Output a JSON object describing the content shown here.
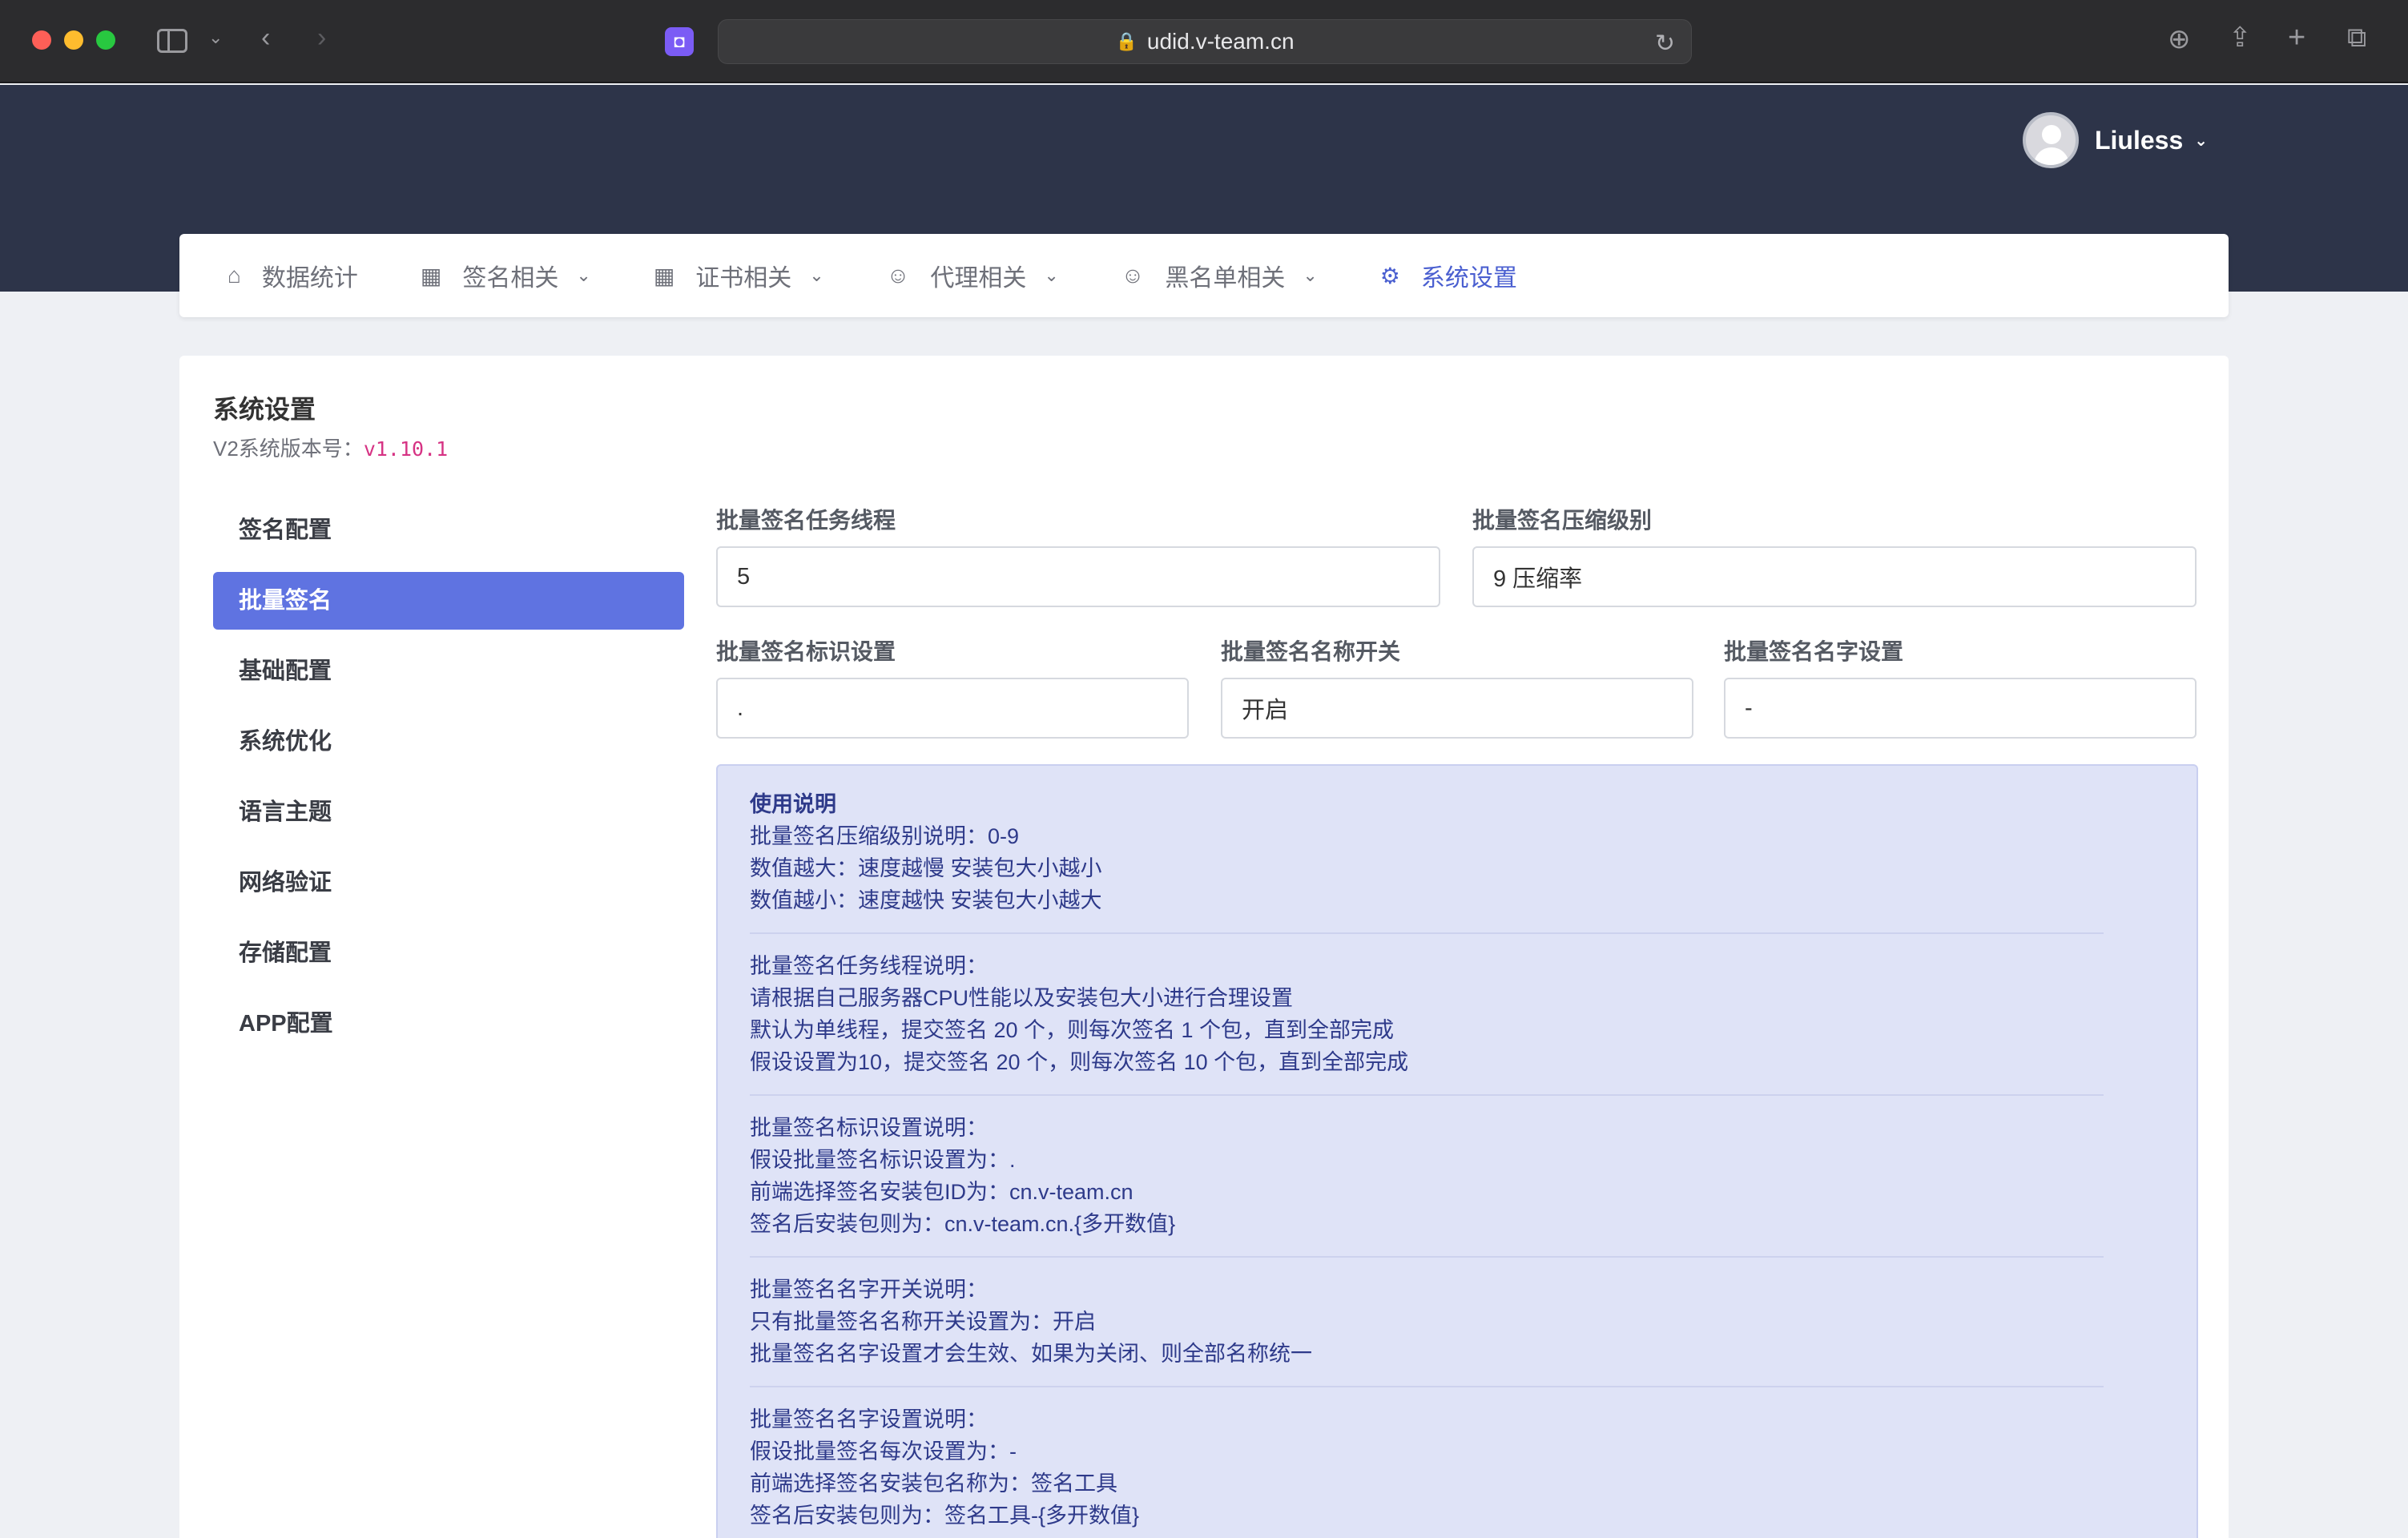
{
  "browser": {
    "url": "udid.v-team.cn"
  },
  "header": {
    "username": "Liuless"
  },
  "nav": {
    "items": [
      {
        "label": "数据统计",
        "icon": "home-icon",
        "dropdown": false
      },
      {
        "label": "签名相关",
        "icon": "grid-icon",
        "dropdown": true
      },
      {
        "label": "证书相关",
        "icon": "grid-icon",
        "dropdown": true
      },
      {
        "label": "代理相关",
        "icon": "users-icon",
        "dropdown": true
      },
      {
        "label": "黑名单相关",
        "icon": "users-icon",
        "dropdown": true
      },
      {
        "label": "系统设置",
        "icon": "gear-icon",
        "dropdown": false,
        "active": true
      }
    ]
  },
  "page": {
    "title": "系统设置",
    "version_label": "V2系统版本号：",
    "version_value": "v1.10.1"
  },
  "side_menu": {
    "items": [
      {
        "label": "签名配置"
      },
      {
        "label": "批量签名",
        "active": true
      },
      {
        "label": "基础配置"
      },
      {
        "label": "系统优化"
      },
      {
        "label": "语言主题"
      },
      {
        "label": "网络验证"
      },
      {
        "label": "存储配置"
      },
      {
        "label": "APP配置"
      }
    ]
  },
  "form": {
    "threads": {
      "label": "批量签名任务线程",
      "value": "5"
    },
    "compress": {
      "label": "批量签名压缩级别",
      "value": "9 压缩率"
    },
    "identifier": {
      "label": "批量签名标识设置",
      "value": "."
    },
    "name_switch": {
      "label": "批量签名名称开关",
      "value": "开启"
    },
    "name_setting": {
      "label": "批量签名名字设置",
      "value": "-"
    }
  },
  "notice": {
    "title": "使用说明",
    "sections": [
      [
        "批量签名压缩级别说明：0-9",
        "数值越大：速度越慢 安装包大小越小",
        "数值越小：速度越快 安装包大小越大"
      ],
      [
        "批量签名任务线程说明：",
        "请根据自己服务器CPU性能以及安装包大小进行合理设置",
        "默认为单线程，提交签名 20 个，则每次签名 1 个包，直到全部完成",
        "假设设置为10，提交签名 20 个，则每次签名 10 个包，直到全部完成"
      ],
      [
        "批量签名标识设置说明：",
        "假设批量签名标识设置为：.",
        "前端选择签名安装包ID为：cn.v-team.cn",
        "签名后安装包则为：cn.v-team.cn.{多开数值}"
      ],
      [
        "批量签名名字开关说明：",
        "只有批量签名名称开关设置为：开启",
        "批量签名名字设置才会生效、如果为关闭、则全部名称统一"
      ],
      [
        "批量签名名字设置说明：",
        "假设批量签名每次设置为：-",
        "前端选择签名安装包名称为：签名工具",
        "签名后安装包则为：签名工具-{多开数值}"
      ]
    ]
  },
  "colors": {
    "header_bg": "#2d3449",
    "accent": "#5f73e1",
    "notice_bg": "#dfe3f7",
    "notice_text": "#2e3a8a",
    "version_code": "#d63384"
  }
}
